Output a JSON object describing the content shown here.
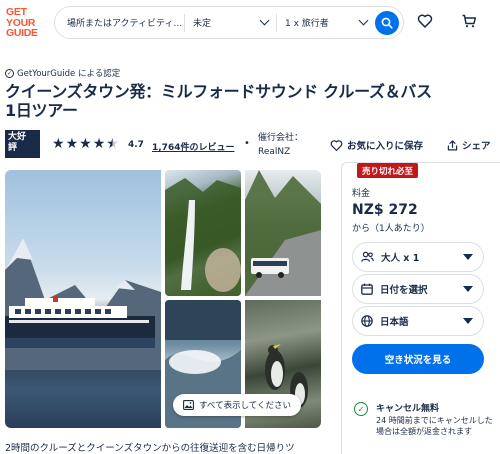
{
  "header": {
    "logo_lines": [
      "GET",
      "YOUR",
      "GUIDE"
    ],
    "search_place_placeholder": "場所またはアクティビティ...",
    "search_date": "未定",
    "search_people": "1 x 旅行者"
  },
  "activity": {
    "verified": "GetYourGuide による認定",
    "title_line1": "クイーンズタウン発：ミルフォードサウンド クルーズ＆バス",
    "title_line2": "1日ツアー",
    "badge_line1": "大好",
    "badge_line2": "評",
    "rating": "4.7",
    "reviews": "1,764件のレビュー",
    "separator": "•",
    "operator_label": "催行会社：",
    "operator_name": "RealNZ",
    "wishlist": "お気に入りに保存",
    "share": "シェア",
    "show_all_photos": "すべて表示してください",
    "description": "2時間のクルーズとクイーンズタウンからの往復送迎を含む日帰りツ"
  },
  "booking": {
    "soldout": "売り切れ必至",
    "price_label": "料金",
    "price": "NZ$ 272",
    "per_person": "から（1人あたり）",
    "participants": "大人 x 1",
    "date": "日付を選択",
    "language": "日本語",
    "check_availability": "空き状況を見る",
    "cancel_title": "キャンセル無料",
    "cancel_text": "24 時間前までにキャンセルした場合は全額が返金されます"
  },
  "colors": {
    "brand": "#ff5533",
    "primary": "#0071eb",
    "text": "#1a2b49",
    "soldout": "#c2181b",
    "success": "#1a8a3b"
  }
}
